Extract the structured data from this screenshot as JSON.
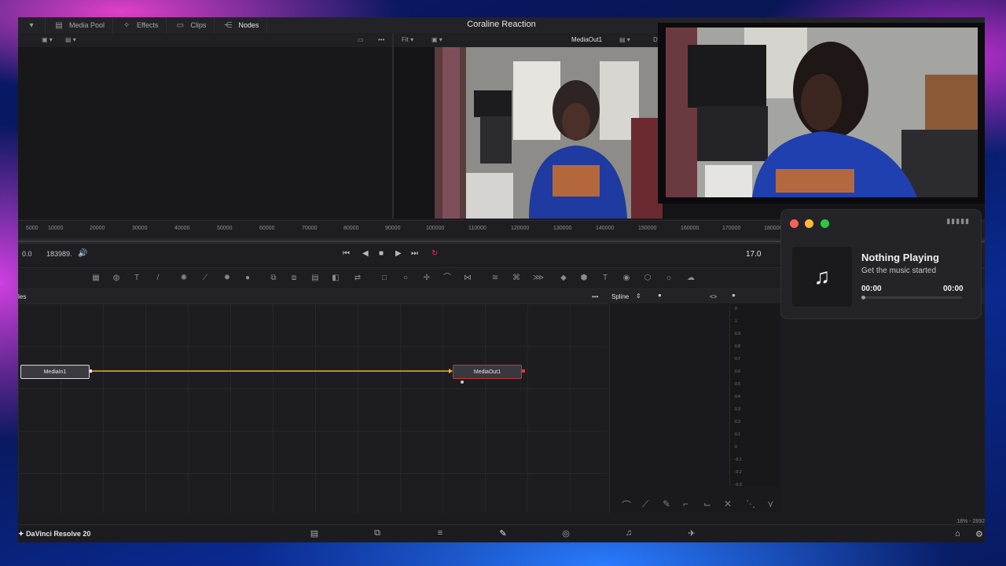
{
  "topbar": {
    "media_pool": "Media Pool",
    "effects": "Effects",
    "clips": "Clips",
    "nodes": "Nodes",
    "project_title": "Coraline Reaction"
  },
  "viewer": {
    "fit": "Fit",
    "output_name": "MediaOut1",
    "extra": "D"
  },
  "ruler": {
    "ticks": [
      "5000",
      "10000",
      "20000",
      "30000",
      "40000",
      "50000",
      "60000",
      "70000",
      "80000",
      "90000",
      "100000",
      "110000",
      "120000",
      "130000",
      "140000",
      "150000",
      "160000",
      "170000",
      "180000"
    ]
  },
  "transport": {
    "start": "0.0",
    "end": "183989.",
    "current_frame": "17.0"
  },
  "panels": {
    "nodes_title": "les",
    "spline_title": "Spline"
  },
  "nodes": {
    "media_in": "MediaIn1",
    "media_out": "MediaOut1",
    "link_color": "#e8b62a"
  },
  "spline_graph": {
    "values": [
      "0",
      "1",
      "0.9",
      "0.8",
      "0.7",
      "0.6",
      "0.5",
      "0.4",
      "0.3",
      "0.2",
      "0.1",
      "0",
      "-0.1",
      "-0.2",
      "-0.3"
    ]
  },
  "footer": {
    "app_name": "DaVinci Resolve 20",
    "zoom": "18% - 2892"
  },
  "music_widget": {
    "title": "Nothing Playing",
    "subtitle": "Get the music started",
    "elapsed": "00:00",
    "duration": "00:00",
    "progress": 0
  },
  "colors": {
    "close": "#ff5f57",
    "minimize": "#febc2e",
    "maximize": "#28c840",
    "active_page": "#e0306a"
  }
}
